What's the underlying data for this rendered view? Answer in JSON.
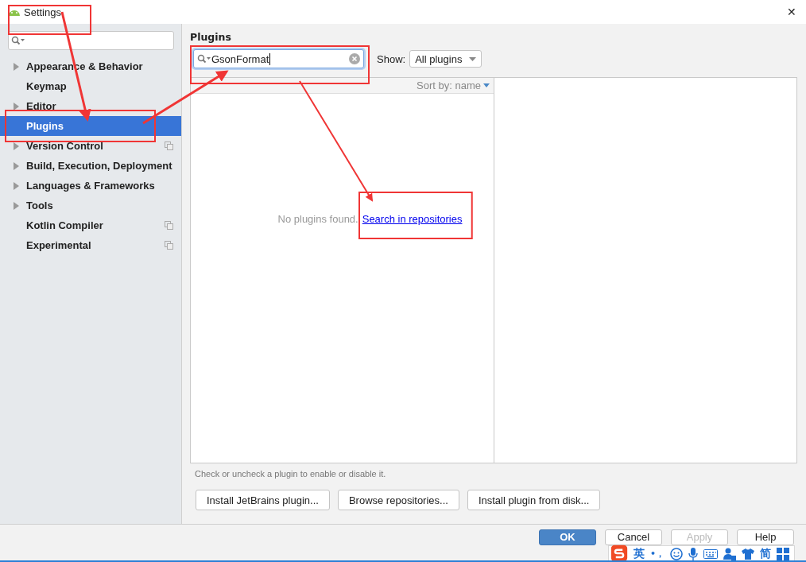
{
  "window": {
    "title": "Settings",
    "close": "✕"
  },
  "sidebar": {
    "items": [
      {
        "label": "Appearance & Behavior",
        "expandable": true,
        "project_level": false,
        "selected": false
      },
      {
        "label": "Keymap",
        "expandable": false,
        "project_level": false,
        "selected": false
      },
      {
        "label": "Editor",
        "expandable": true,
        "project_level": false,
        "selected": false
      },
      {
        "label": "Plugins",
        "expandable": false,
        "project_level": false,
        "selected": true
      },
      {
        "label": "Version Control",
        "expandable": true,
        "project_level": true,
        "selected": false
      },
      {
        "label": "Build, Execution, Deployment",
        "expandable": true,
        "project_level": false,
        "selected": false
      },
      {
        "label": "Languages & Frameworks",
        "expandable": true,
        "project_level": false,
        "selected": false
      },
      {
        "label": "Tools",
        "expandable": true,
        "project_level": false,
        "selected": false
      },
      {
        "label": "Kotlin Compiler",
        "expandable": false,
        "project_level": true,
        "selected": false
      },
      {
        "label": "Experimental",
        "expandable": false,
        "project_level": true,
        "selected": false
      }
    ]
  },
  "plugins": {
    "title": "Plugins",
    "search": {
      "value": "GsonFormat"
    },
    "show_label": "Show:",
    "show_value": "All plugins",
    "sort": "Sort by: name",
    "empty_text": "No plugins found.",
    "empty_link": "Search in repositories",
    "hint": "Check or uncheck a plugin to enable or disable it.",
    "buttons": [
      "Install JetBrains plugin...",
      "Browse repositories...",
      "Install plugin from disk..."
    ]
  },
  "dialog_buttons": [
    {
      "label": "OK",
      "kind": "primary",
      "disabled": false
    },
    {
      "label": "Cancel",
      "kind": "normal",
      "disabled": false
    },
    {
      "label": "Apply",
      "kind": "normal",
      "disabled": true
    },
    {
      "label": "Help",
      "kind": "normal",
      "disabled": false
    }
  ],
  "ime_bar": {
    "language": "英",
    "punctuation": "•，",
    "script": "简"
  }
}
